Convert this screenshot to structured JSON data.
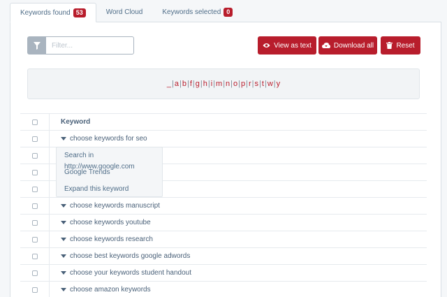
{
  "tabs": [
    {
      "label": "Keywords found",
      "badge": "53"
    },
    {
      "label": "Word Cloud"
    },
    {
      "label": "Keywords selected",
      "badge": "0"
    }
  ],
  "toolbar": {
    "filter_placeholder": "Filter...",
    "view_label": "View as text",
    "download_label": "Download all",
    "reset_label": "Reset"
  },
  "alphabet": [
    "_",
    "a",
    "b",
    "f",
    "g",
    "h",
    "i",
    "m",
    "n",
    "o",
    "p",
    "r",
    "s",
    "t",
    "w",
    "y"
  ],
  "table": {
    "header": "Keyword",
    "rows": [
      "choose keywords for seo",
      "",
      "",
      "",
      "choose keywords manuscript",
      "choose keywords youtube",
      "choose keywords research",
      "choose best keywords google adwords",
      "choose your keywords student handout",
      "choose amazon keywords"
    ]
  },
  "context_menu": [
    "Search in http://www.google.com",
    "Google Trends",
    "Expand this keyword"
  ],
  "colors": {
    "accent": "#b81d2c",
    "text": "#4a6179",
    "filter_button": "#a9b4bf"
  }
}
